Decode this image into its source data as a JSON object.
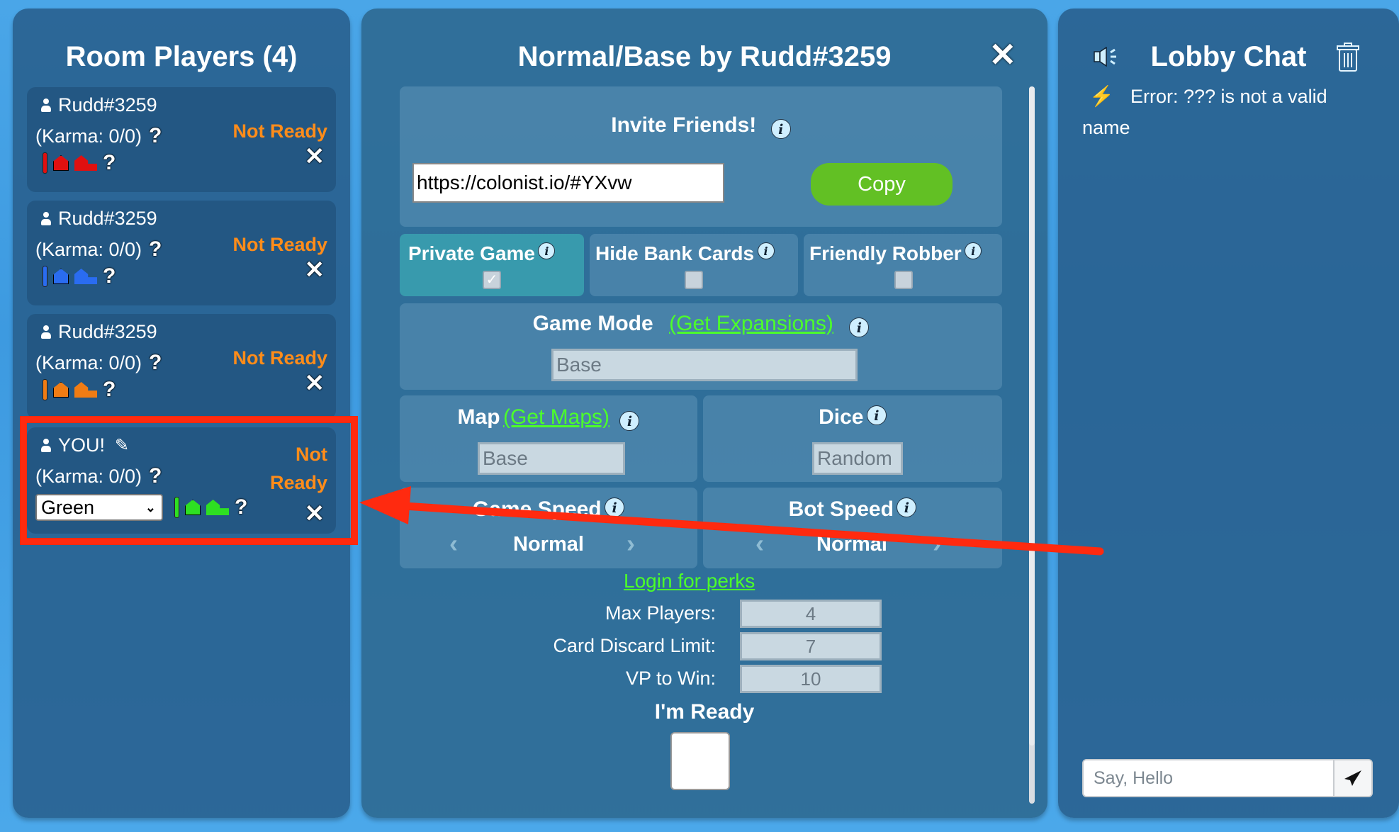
{
  "room_players": {
    "title": "Room Players (4)",
    "players": [
      {
        "name": "Rudd#3259",
        "karma": "(Karma: 0/0)",
        "help": "?",
        "status": "Not Ready",
        "kick": "✕",
        "color_hex": "#e01010"
      },
      {
        "name": "Rudd#3259",
        "karma": "(Karma: 0/0)",
        "help": "?",
        "status": "Not Ready",
        "kick": "✕",
        "color_hex": "#2a6cf0"
      },
      {
        "name": "Rudd#3259",
        "karma": "(Karma: 0/0)",
        "help": "?",
        "status": "Not Ready",
        "kick": "✕",
        "color_hex": "#f07c14"
      },
      {
        "name": "YOU!",
        "karma": "(Karma: 0/0)",
        "help": "?",
        "status_line1": "Not",
        "status_line2": "Ready",
        "kick": "✕",
        "color_select": "Green",
        "color_hex": "#2ee022"
      }
    ]
  },
  "game_settings": {
    "title": "Normal/Base by Rudd#3259",
    "close": "✕",
    "invite": {
      "label": "Invite Friends!",
      "url": "https://colonist.io/#YXvw",
      "copy_label": "Copy"
    },
    "toggles": [
      {
        "label": "Private Game",
        "checked": true
      },
      {
        "label": "Hide Bank Cards",
        "checked": false
      },
      {
        "label": "Friendly Robber",
        "checked": false
      }
    ],
    "game_mode": {
      "label": "Game Mode",
      "link": "(Get Expansions)",
      "value": "Base"
    },
    "map": {
      "label": "Map",
      "link": "(Get Maps)",
      "value": "Base"
    },
    "dice": {
      "label": "Dice",
      "value": "Random"
    },
    "game_speed": {
      "label": "Game Speed",
      "value": "Normal"
    },
    "bot_speed": {
      "label": "Bot Speed",
      "value": "Normal"
    },
    "login_link": "Login for perks",
    "fields": [
      {
        "label": "Max Players:",
        "value": "4"
      },
      {
        "label": "Card Discard Limit:",
        "value": "7"
      },
      {
        "label": "VP to Win:",
        "value": "10"
      }
    ],
    "ready_label": "I'm Ready",
    "info_glyph": "i"
  },
  "lobby_chat": {
    "title": "Lobby Chat",
    "messages": [
      {
        "icon": "lightning-bolt",
        "text": "Error: ??? is not a valid name"
      }
    ],
    "input_placeholder": "Say, Hello"
  },
  "annotation": {
    "highlight_color": "#ff2a0f",
    "target": "YOU! player card"
  }
}
